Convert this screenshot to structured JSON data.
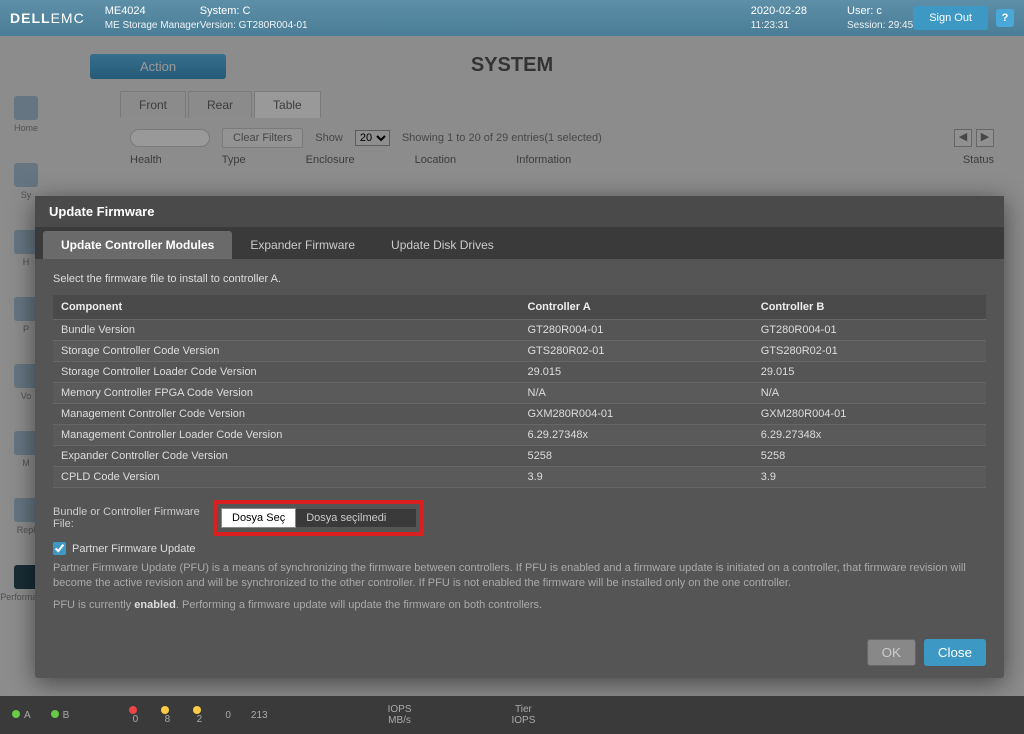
{
  "header": {
    "brand": "DELL",
    "brand2": "EMC",
    "product": "ME4024",
    "product_sub": "ME Storage Manager",
    "system_label": "System: C",
    "version_label": "Version: GT280R004-01",
    "date": "2020-02-28",
    "time": "11:23:31",
    "user_label": "User: c",
    "session_label": "Session: 29:45",
    "signout": "Sign Out",
    "help": "?"
  },
  "action_button": "Action",
  "page_title": "SYSTEM",
  "bg_tabs": {
    "front": "Front",
    "rear": "Rear",
    "table": "Table"
  },
  "filters": {
    "clear": "Clear Filters",
    "show": "Show",
    "show_value": "20",
    "showing": "Showing 1 to 20 of 29 entries(1 selected)"
  },
  "columns": [
    "Health",
    "Type",
    "Enclosure",
    "Location",
    "Information",
    "Status"
  ],
  "sidebar": [
    "Home",
    "Sy",
    "H",
    "P",
    "Vo",
    "M",
    "Repl",
    "Performance"
  ],
  "modal": {
    "title": "Update Firmware",
    "tabs": {
      "controller": "Update Controller Modules",
      "expander": "Expander Firmware",
      "disk": "Update Disk Drives"
    },
    "instruction": "Select the firmware file to install to controller A.",
    "th": {
      "component": "Component",
      "a": "Controller A",
      "b": "Controller B"
    },
    "rows": [
      {
        "c": "Bundle Version",
        "a": "GT280R004-01",
        "b": "GT280R004-01"
      },
      {
        "c": "Storage Controller Code Version",
        "a": "GTS280R02-01",
        "b": "GTS280R02-01"
      },
      {
        "c": "Storage Controller Loader Code Version",
        "a": "29.015",
        "b": "29.015"
      },
      {
        "c": "Memory Controller FPGA Code Version",
        "a": "N/A",
        "b": "N/A"
      },
      {
        "c": "Management Controller Code Version",
        "a": "GXM280R004-01",
        "b": "GXM280R004-01"
      },
      {
        "c": "Management Controller Loader Code Version",
        "a": "6.29.27348x",
        "b": "6.29.27348x"
      },
      {
        "c": "Expander Controller Code Version",
        "a": "5258",
        "b": "5258"
      },
      {
        "c": "CPLD Code Version",
        "a": "3.9",
        "b": "3.9"
      }
    ],
    "file_label": "Bundle or Controller Firmware File:",
    "file_btn": "Dosya Seç",
    "file_status": "Dosya seçilmedi",
    "pfu_checkbox": "Partner Firmware Update",
    "desc1": "Partner Firmware Update (PFU) is a means of synchronizing the firmware between controllers. If PFU is enabled and a firmware update is initiated on a controller, that firmware revision will become the active revision and will be synchronized to the other controller. If PFU is not enabled the firmware will be installed only on the one controller.",
    "desc2a": "PFU is currently ",
    "desc2b": "enabled",
    "desc2c": ". Performing a firmware update will update the firmware on both controllers.",
    "ok": "OK",
    "close": "Close"
  },
  "footer": {
    "a": "A",
    "b": "B",
    "stats": [
      "0",
      "8",
      "2",
      "0",
      "213"
    ],
    "iops": "IOPS",
    "mbs": "MB/s",
    "tier": "Tier",
    "tier_iops": "IOPS"
  }
}
